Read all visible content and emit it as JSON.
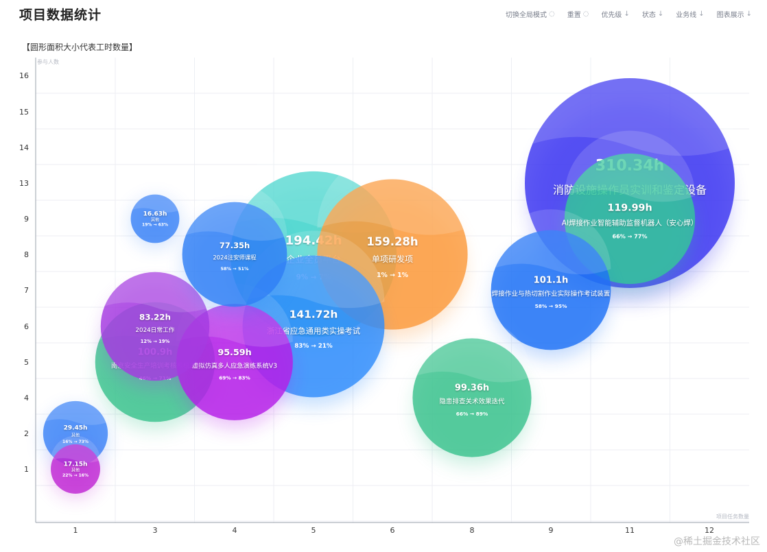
{
  "header": {
    "title": "项目数据统计",
    "tools": [
      {
        "label": "切换全局模式",
        "icon": "loading-circle-icon"
      },
      {
        "label": "重置",
        "icon": "loading-circle-icon"
      },
      {
        "label": "优先级",
        "icon": "arrow-down-icon"
      },
      {
        "label": "状态",
        "icon": "arrow-down-icon"
      },
      {
        "label": "业务线",
        "icon": "arrow-down-icon"
      },
      {
        "label": "图表展示",
        "icon": "arrow-down-icon"
      }
    ]
  },
  "watermark": "@稀土掘金技术社区",
  "chart_data": {
    "type": "scatter",
    "title": "【圆形面积大小代表工时数量】",
    "ylabel": "参与人数",
    "xlabel": "项目任务数量",
    "x_ticks": [
      "1",
      "3",
      "4",
      "5",
      "6",
      "8",
      "9",
      "11",
      "12"
    ],
    "y_ticks": [
      "1",
      "2",
      "4",
      "5",
      "6",
      "7",
      "8",
      "9",
      "13",
      "14",
      "15",
      "16"
    ],
    "grid": true,
    "arrow_glyph": "→",
    "bubbles": [
      {
        "x": "11",
        "y": "13",
        "hours": "310.34h",
        "name": "消防设施操作员实训和鉴定设备",
        "from": "",
        "to": "",
        "color": "#3b35f0"
      },
      {
        "x": "5",
        "y": "8",
        "hours": "194.42h",
        "name": "企业全员平台",
        "from": "9%",
        "to": "7%",
        "color": "#3fd3cb"
      },
      {
        "x": "6",
        "y": "8",
        "hours": "159.28h",
        "name": "单项研发项",
        "from": "1%",
        "to": "1%",
        "color": "#fb9a3c"
      },
      {
        "x": "5",
        "y": "6",
        "hours": "141.72h",
        "name": "浙江省应急通用类实操考试",
        "from": "83%",
        "to": "21%",
        "color": "#2f8cfb"
      },
      {
        "x": "11",
        "y": "9",
        "hours": "119.99h",
        "name": "AI焊接作业智能辅助监督机器人（安心焊）",
        "from": "66%",
        "to": "77%",
        "color": "#35c79a"
      },
      {
        "x": "9",
        "y": "7",
        "hours": "101.1h",
        "name": "焊接作业与热切割作业实际操作考试装置",
        "from": "58%",
        "to": "95%",
        "color": "#1f72f5"
      },
      {
        "x": "3",
        "y": "5",
        "hours": "100.9h",
        "name": "南京安全生产培训考核系统3D",
        "from": "46%",
        "to": "71%",
        "color": "#3ac28d"
      },
      {
        "x": "8",
        "y": "4",
        "hours": "99.36h",
        "name": "隐患排查关术效果迭代",
        "from": "66%",
        "to": "89%",
        "color": "#3ac28d"
      },
      {
        "x": "4",
        "y": "5",
        "hours": "95.59h",
        "name": "虚拟仿真多人应急演练系统V3",
        "from": "69%",
        "to": "83%",
        "color": "#b51fe8"
      },
      {
        "x": "3",
        "y": "6",
        "hours": "83.22h",
        "name": "2024日常工作",
        "from": "12%",
        "to": "19%",
        "color": "#a53be0"
      },
      {
        "x": "4",
        "y": "8",
        "hours": "77.35h",
        "name": "2024注安师课程",
        "from": "58%",
        "to": "51%",
        "color": "#2f7ff5"
      },
      {
        "x": "1",
        "y": "2",
        "hours": "29.45h",
        "name": "其他",
        "from": "16%",
        "to": "73%",
        "color": "#3b82f6"
      },
      {
        "x": "1",
        "y": "1",
        "hours": "17.15h",
        "name": "其他",
        "from": "22%",
        "to": "16%",
        "color": "#c026d3"
      },
      {
        "x": "3",
        "y": "9",
        "hours": "16.63h",
        "name": "其他",
        "from": "19%",
        "to": "63%",
        "color": "#3b82f6"
      }
    ]
  }
}
